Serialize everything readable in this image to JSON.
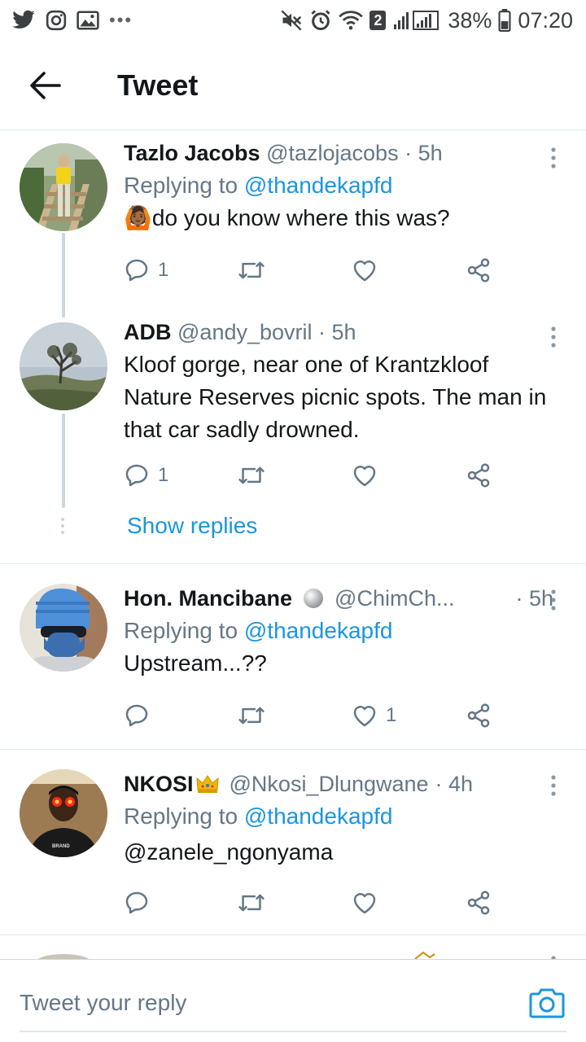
{
  "status_bar": {
    "battery": "38%",
    "time": "07:20",
    "wifi_badge": "2"
  },
  "header": {
    "title": "Tweet"
  },
  "tweets": [
    {
      "name": "Tazlo Jacobs",
      "handle": "@tazlojacobs",
      "time": "· 5h",
      "replying_label": "Replying to",
      "replying_to": "@thandekapfd",
      "emoji": "🙆🏾",
      "text": "do you know where this was?",
      "reply_count": "1",
      "like_count": ""
    },
    {
      "name": "ADB",
      "handle": "@andy_bovril",
      "time": "· 5h",
      "text": "Kloof gorge, near one of Krantzkloof Nature Reserves picnic spots. The man in that car sadly drowned.",
      "reply_count": "1",
      "like_count": "",
      "show_replies": "Show replies"
    },
    {
      "name": "Hon. Mancibane",
      "handle": "@ChimCh...",
      "time": "· 5h",
      "replying_label": "Replying to",
      "replying_to": "@thandekapfd",
      "text": "Upstream...??",
      "reply_count": "",
      "like_count": "1"
    },
    {
      "name": "NKOSI",
      "handle": "@Nkosi_Dlungwane",
      "time": "· 4h",
      "replying_label": "Replying to",
      "replying_to": "@thandekapfd",
      "text": "@zanele_ngonyama",
      "reply_count": "",
      "like_count": ""
    }
  ],
  "reply_bar": {
    "placeholder": "Tweet your reply"
  },
  "colors": {
    "accent": "#1b95e0",
    "secondary_text": "#657786",
    "divider": "#e1e8ed"
  }
}
